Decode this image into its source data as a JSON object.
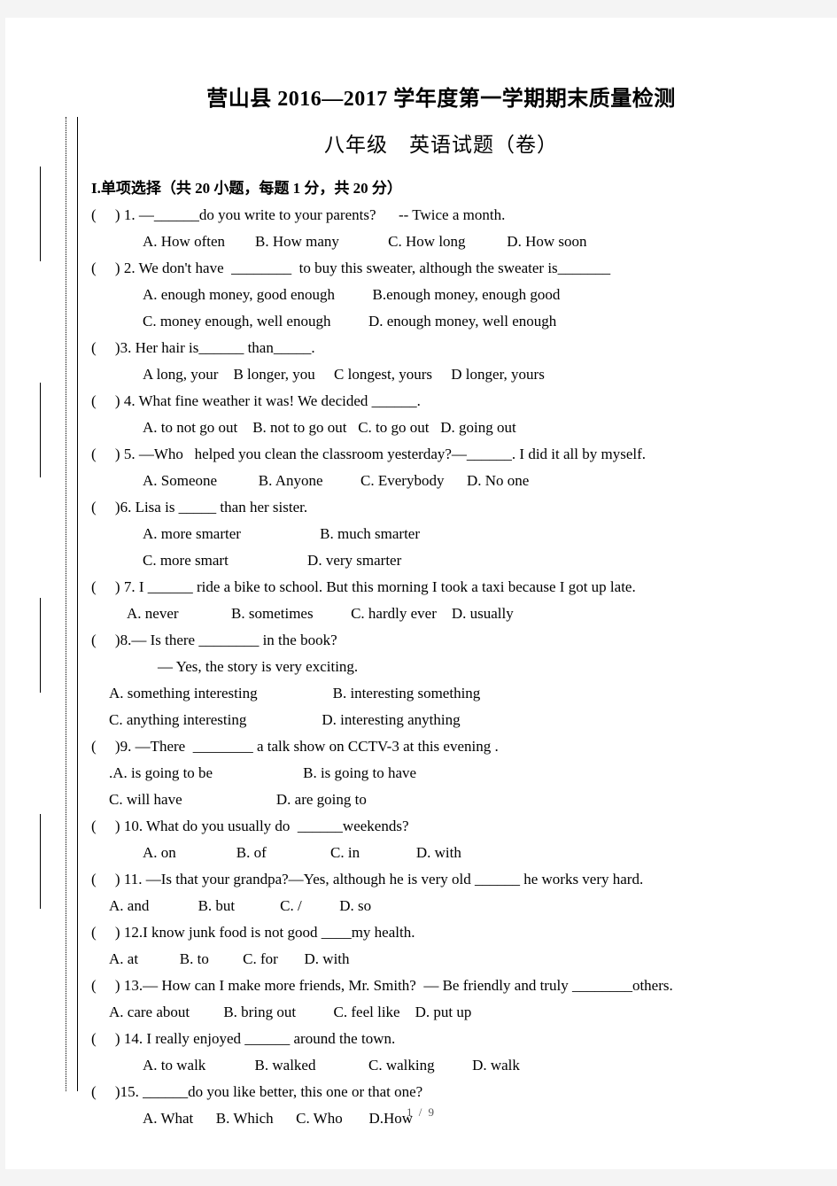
{
  "document": {
    "title": "营山县 2016—2017 学年度第一学期期末质量检测",
    "subtitle": "八年级　英语试题（卷）",
    "footer": "1 / 9"
  },
  "section": {
    "heading": "I.单项选择（共 20 小题，每题 1 分，共 20 分）"
  },
  "questions": [
    {
      "stem": "(     ) 1. —______do you write to your parents?      -- Twice a month.",
      "options": [
        "A. How often        B. How many             C. How long           D. How soon"
      ]
    },
    {
      "stem": "(     ) 2. We don't have  ________  to buy this sweater, although the sweater is_______",
      "options": [
        "A. enough money, good enough          B.enough money, enough good",
        "C. money enough, well enough          D. enough money, well enough"
      ]
    },
    {
      "stem": "(     )3. Her hair is______ than_____.",
      "options": [
        "A long, your    B longer, you     C longest, yours     D longer, yours"
      ]
    },
    {
      "stem": "(     ) 4. What fine weather it was! We decided ______.",
      "options": [
        "A. to not go out    B. not to go out   C. to go out   D. going out"
      ]
    },
    {
      "stem": "(     ) 5. —Who   helped you clean the classroom yesterday?—______. I did it all by myself.",
      "options": [
        "A. Someone           B. Anyone          C. Everybody      D. No one"
      ]
    },
    {
      "stem": "(     )6. Lisa is _____ than her sister.",
      "options": [
        "A. more smarter                     B. much smarter",
        "C. more smart                     D. very smarter"
      ]
    },
    {
      "stem": "(     ) 7. I ______ ride a bike to school. But this morning I took a taxi because I got up late.",
      "options": [
        "A. never              B. sometimes          C. hardly ever    D. usually"
      ]
    },
    {
      "stem": "(     )8.— Is there ________ in the book?",
      "stem2": "— Yes, the story is very exciting.",
      "options": [
        "A. something interesting                    B. interesting something",
        "C. anything interesting                    D. interesting anything"
      ]
    },
    {
      "stem": "(     )9. —There  ________ a talk show on CCTV-3 at this evening .",
      "options": [
        ".A. is going to be                        B. is going to have",
        "C. will have                         D. are going to"
      ]
    },
    {
      "stem": "(     ) 10. What do you usually do  ______weekends?",
      "options": [
        "A. on                B. of                 C. in               D. with"
      ]
    },
    {
      "stem": "(     ) 11. —Is that your grandpa?—Yes, although he is very old ______ he works very hard.",
      "options": [
        "A. and             B. but            C. /          D. so"
      ]
    },
    {
      "stem": "(     ) 12.I know junk food is not good ____my health.",
      "options": [
        "A. at           B. to         C. for       D. with"
      ]
    },
    {
      "stem": "(     ) 13.— How can I make more friends, Mr. Smith?  — Be friendly and truly ________others.",
      "options": [
        "A. care about         B. bring out          C. feel like    D. put up"
      ]
    },
    {
      "stem": "(     ) 14. I really enjoyed ______ around the town.",
      "options": [
        "A. to walk             B. walked              C. walking          D. walk"
      ]
    },
    {
      "stem": "(     )15. ______do you like better, this one or that one?",
      "options": [
        "A. What      B. Which      C. Who       D.How"
      ]
    }
  ]
}
